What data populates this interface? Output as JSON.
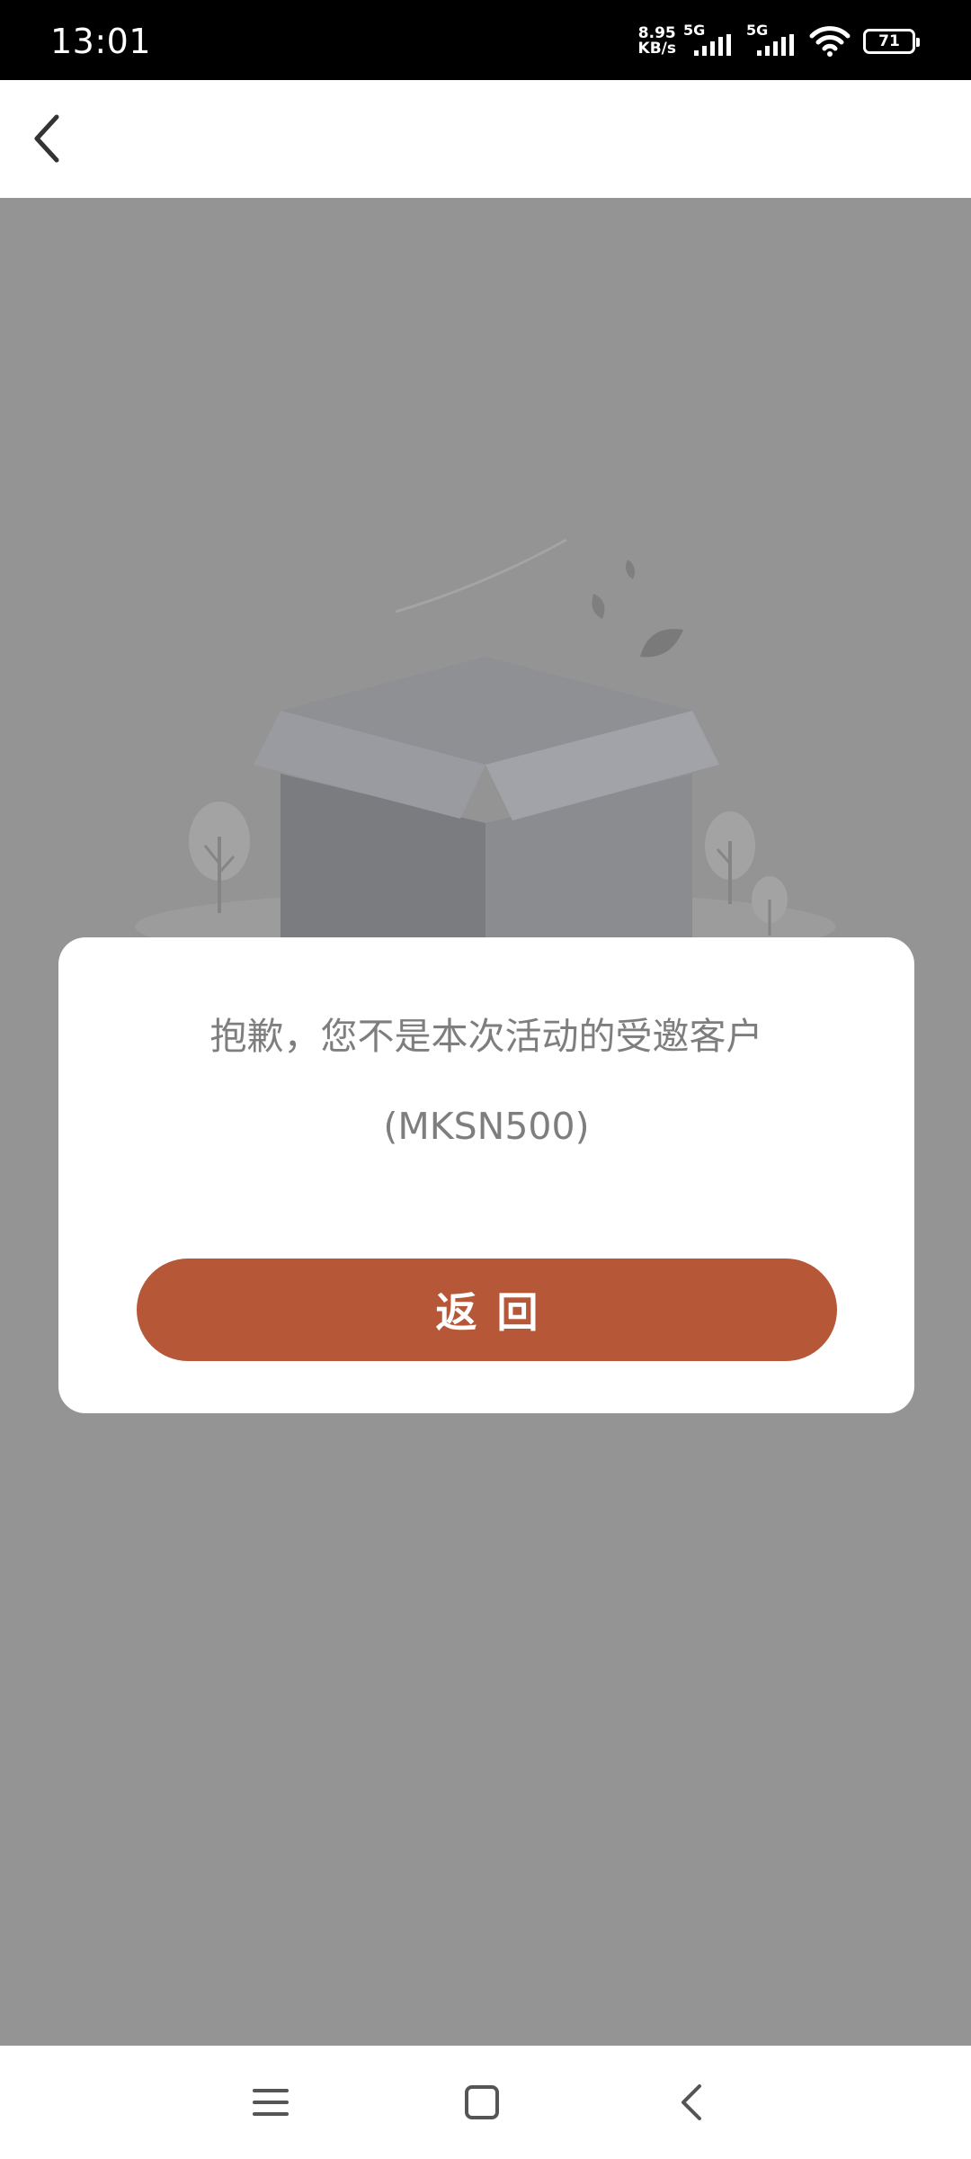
{
  "status_bar": {
    "time": "13:01",
    "net_speed_value": "8.95",
    "net_speed_unit": "KB/s",
    "sim1_label": "5G",
    "sim2_label": "5G",
    "battery_level": "71",
    "icons": [
      "signal-icon",
      "signal-icon",
      "wifi-icon",
      "battery-icon"
    ]
  },
  "header": {
    "back_icon": "chevron-left-icon"
  },
  "dialog": {
    "message": "抱歉，您不是本次活动的受邀客户(MKSN500)",
    "button_label": "返回",
    "button_color": "#b65738"
  },
  "nav_bar": {
    "icons": [
      "menu-icon",
      "home-icon",
      "back-icon"
    ]
  },
  "colors": {
    "overlay_background": "#949494",
    "accent": "#b65738",
    "message_text": "#7e7e7e"
  }
}
